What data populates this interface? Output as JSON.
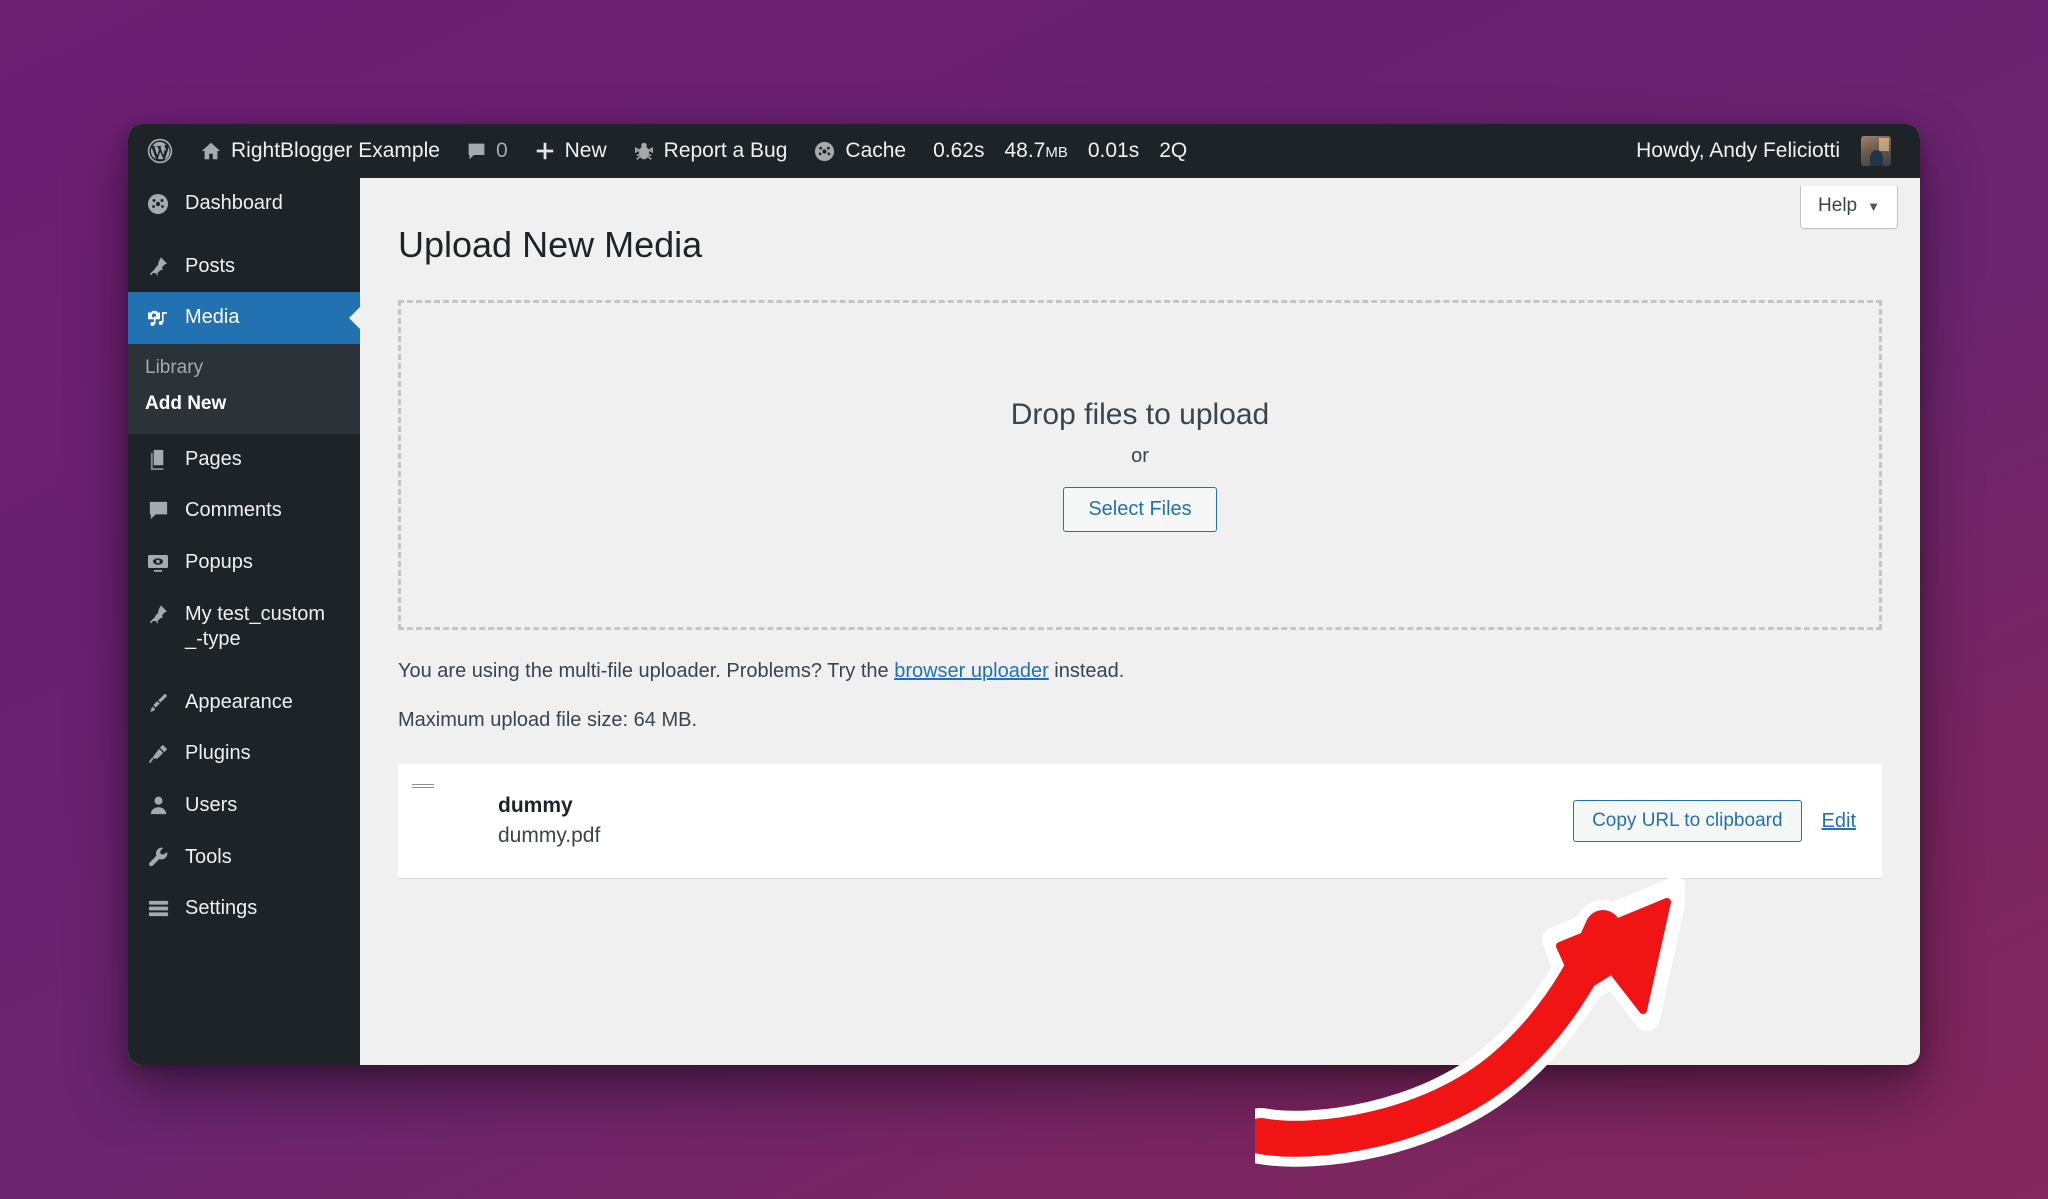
{
  "adminbar": {
    "wp_logo_icon": "wordpress-logo-icon",
    "site_icon": "home-icon",
    "site_name": "RightBlogger Example",
    "comments_icon": "comment-bubble-icon",
    "comments_count": "0",
    "new_icon": "plus-icon",
    "new_label": "New",
    "bug_icon": "bug-icon",
    "bug_label": "Report a Bug",
    "cache_icon": "speedometer-icon",
    "cache_label": "Cache",
    "stats": [
      {
        "value": "0.62s",
        "unit": ""
      },
      {
        "value": "48.7",
        "unit": "MB"
      },
      {
        "value": "0.01s",
        "unit": ""
      },
      {
        "value": "2Q",
        "unit": ""
      }
    ],
    "greeting": "Howdy, Andy Feliciotti",
    "avatar_name": "user-avatar"
  },
  "sidebar": {
    "items": [
      {
        "label": "Dashboard",
        "icon": "dashboard-speedometer-icon",
        "current": false,
        "name": "dashboard"
      },
      {
        "label": "Posts",
        "icon": "pin-icon",
        "current": false,
        "name": "posts"
      },
      {
        "label": "Media",
        "icon": "media-camera-music-icon",
        "current": true,
        "name": "media"
      },
      {
        "label": "Pages",
        "icon": "pages-stack-icon",
        "current": false,
        "name": "pages"
      },
      {
        "label": "Comments",
        "icon": "comment-bubble-icon",
        "current": false,
        "name": "comments"
      },
      {
        "label": "Popups",
        "icon": "eye-monitor-icon",
        "current": false,
        "name": "popups"
      },
      {
        "label": "My test_custom_-type",
        "icon": "pin-icon",
        "current": false,
        "name": "my-test-custom-type"
      },
      {
        "label": "Appearance",
        "icon": "paintbrush-icon",
        "current": false,
        "name": "appearance"
      },
      {
        "label": "Plugins",
        "icon": "plug-icon",
        "current": false,
        "name": "plugins"
      },
      {
        "label": "Users",
        "icon": "user-icon",
        "current": false,
        "name": "users"
      },
      {
        "label": "Tools",
        "icon": "wrench-icon",
        "current": false,
        "name": "tools"
      },
      {
        "label": "Settings",
        "icon": "sliders-icon",
        "current": false,
        "name": "settings"
      }
    ],
    "submenu": [
      {
        "label": "Library",
        "current": false,
        "name": "media-library"
      },
      {
        "label": "Add New",
        "current": true,
        "name": "media-add-new"
      }
    ]
  },
  "content": {
    "help_label": "Help",
    "help_caret": "▼",
    "page_title": "Upload New Media",
    "dropzone": {
      "title": "Drop files to upload",
      "or": "or",
      "select_files": "Select Files"
    },
    "notice_before": "You are using the multi-file uploader. Problems? Try the ",
    "notice_link": "browser uploader",
    "notice_after": " instead.",
    "max_upload": "Maximum upload file size: 64 MB.",
    "media_item": {
      "title": "dummy",
      "filename": "dummy.pdf",
      "copy_label": "Copy URL to clipboard",
      "edit_label": "Edit",
      "thumb_icon": "pdf-file-icon"
    }
  },
  "annotation": {
    "arrow_name": "red-curved-arrow-annotation",
    "arrow_fill": "#f01414",
    "arrow_stroke": "#ffffff"
  },
  "colors": {
    "admin_blue": "#2271b1",
    "admin_dark": "#1d2327",
    "submenu_bg": "#2c3338",
    "content_bg": "#f0f0f1",
    "desktop_purple": "#6b2070"
  }
}
